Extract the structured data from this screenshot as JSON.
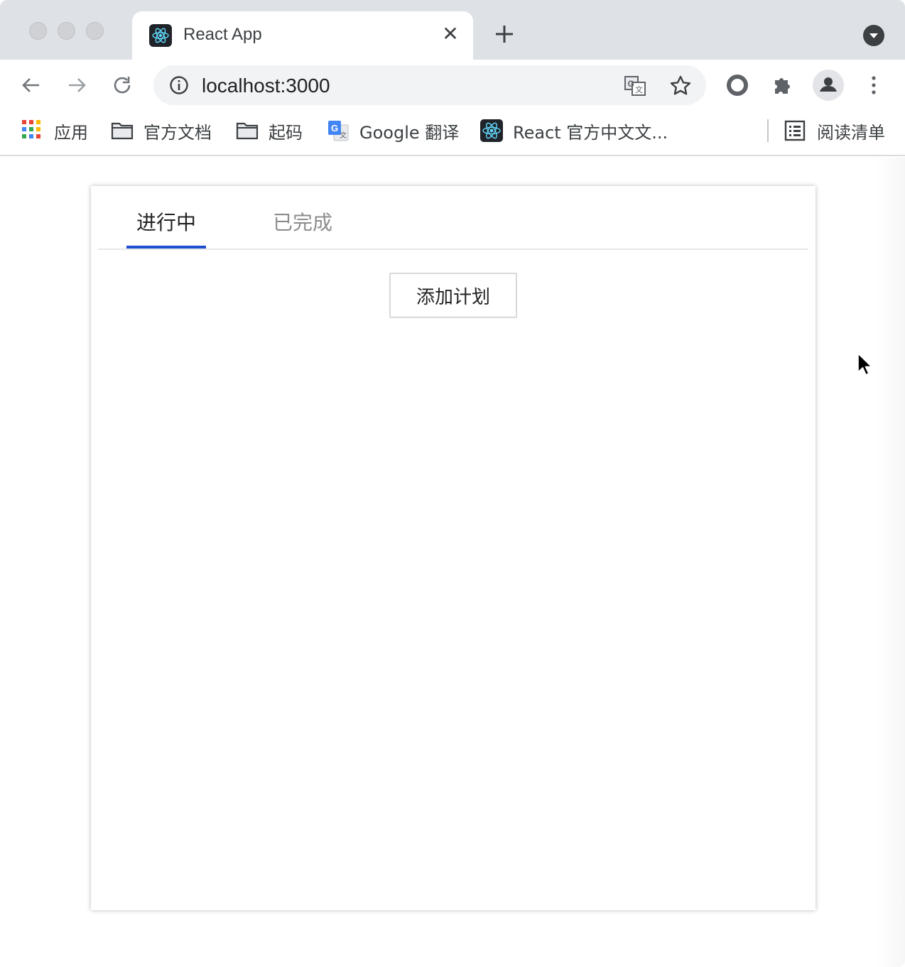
{
  "browser": {
    "tab": {
      "title": "React App",
      "favicon": "react-icon",
      "close": "✕"
    },
    "new_tab": "+",
    "toolbar": {
      "url": "localhost:3000",
      "icons": [
        "back-icon",
        "forward-icon",
        "reload-icon",
        "info-icon",
        "translate-icon",
        "star-icon",
        "extension-circle-icon",
        "puzzle-icon",
        "profile-icon",
        "more-icon"
      ]
    },
    "bookmarks": {
      "items": [
        {
          "label": "应用",
          "icon": "apps-grid-icon"
        },
        {
          "label": "官方文档",
          "icon": "folder-icon"
        },
        {
          "label": "起码",
          "icon": "folder-icon"
        },
        {
          "label": "Google 翻译",
          "icon": "google-translate-icon"
        },
        {
          "label": "React 官方中文文...",
          "icon": "react-icon"
        }
      ],
      "reading_list": {
        "label": "阅读清单",
        "icon": "reading-list-icon"
      }
    }
  },
  "app": {
    "tabs": [
      {
        "label": "进行中",
        "active": true
      },
      {
        "label": "已完成",
        "active": false
      }
    ],
    "add_button": "添加计划",
    "accent_color": "#1f4ecf"
  }
}
